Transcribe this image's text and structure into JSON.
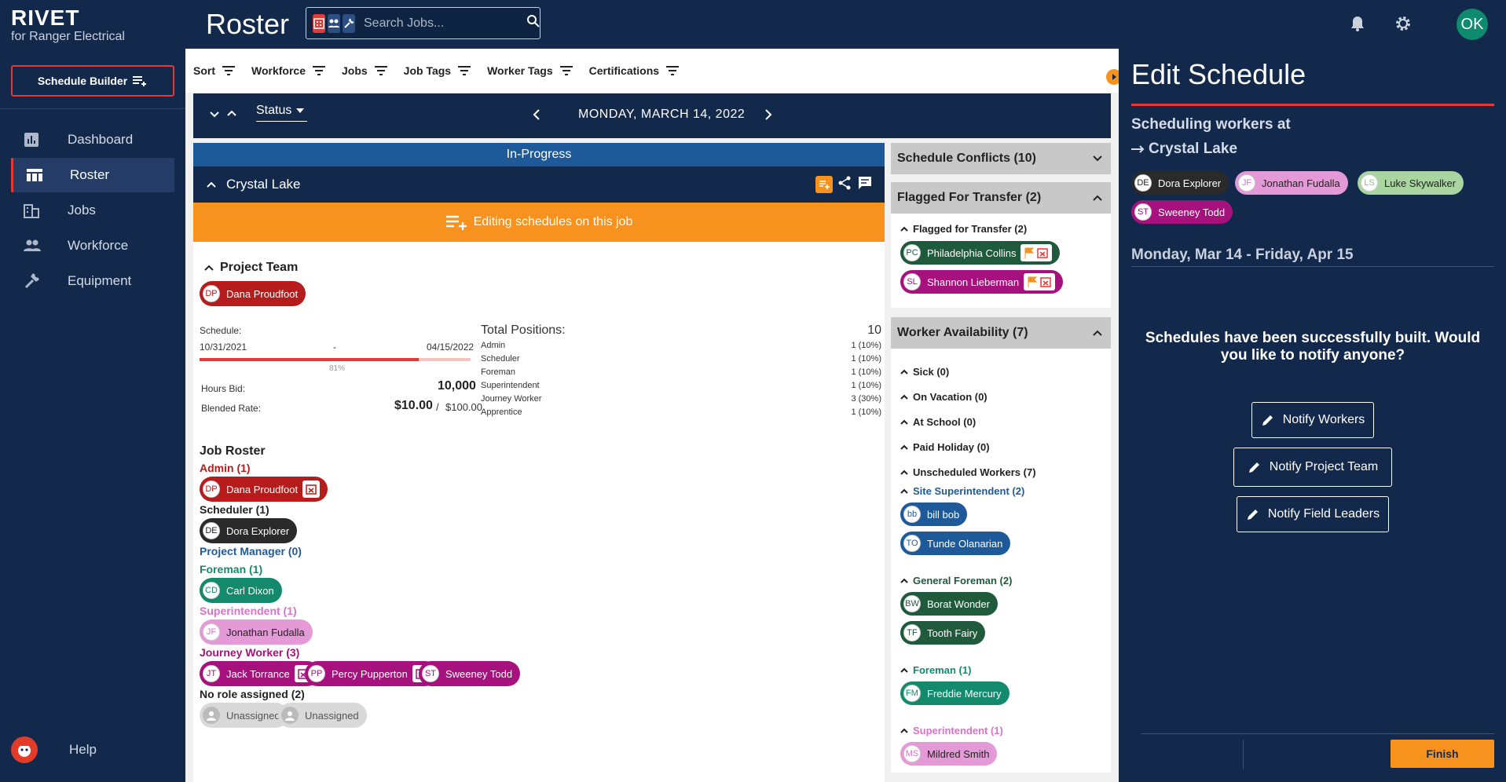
{
  "app": {
    "logo": "RIVET",
    "subtitle": "for Ranger Electrical",
    "page_title": "Roster"
  },
  "search": {
    "placeholder": "Search Jobs..."
  },
  "user": {
    "initials": "OK"
  },
  "sidebar": {
    "builder_label": "Schedule Builder",
    "items": [
      {
        "label": "Dashboard",
        "icon": "dashboard-icon"
      },
      {
        "label": "Roster",
        "icon": "roster-icon",
        "active": true
      },
      {
        "label": "Jobs",
        "icon": "jobs-icon"
      },
      {
        "label": "Workforce",
        "icon": "workforce-icon"
      },
      {
        "label": "Equipment",
        "icon": "equipment-icon"
      }
    ],
    "help": "Help"
  },
  "filters": [
    "Sort",
    "Workforce",
    "Jobs",
    "Job Tags",
    "Worker Tags",
    "Certifications"
  ],
  "datebar": {
    "status": "Status",
    "date": "MONDAY, MARCH 14, 2022"
  },
  "job": {
    "state": "In-Progress",
    "name": "Crystal Lake",
    "editing": "Editing schedules on this job",
    "project_team": {
      "title": "Project Team",
      "member": {
        "initials": "DP",
        "name": "Dana Proudfoot"
      }
    },
    "schedule": {
      "label": "Schedule:",
      "start": "10/31/2021",
      "dash": "-",
      "end": "04/15/2022",
      "progress_pct": 81,
      "progress_label": "81%"
    },
    "hours_bid": {
      "label": "Hours Bid:",
      "value": "10,000"
    },
    "blended": {
      "label": "Blended Rate:",
      "value": "$10.00",
      "sep": "/",
      "alt": "$100.00"
    },
    "positions": {
      "title": "Total Positions:",
      "total": "10",
      "rows": [
        {
          "role": "Admin",
          "value": "1 (10%)"
        },
        {
          "role": "Scheduler",
          "value": "1 (10%)"
        },
        {
          "role": "Foreman",
          "value": "1 (10%)"
        },
        {
          "role": "Superintendent",
          "value": "1 (10%)"
        },
        {
          "role": "Journey Worker",
          "value": "3 (30%)"
        },
        {
          "role": "Apprentice",
          "value": "1 (10%)"
        }
      ]
    },
    "roster_title": "Job Roster",
    "roles": {
      "admin": {
        "label": "Admin (1)",
        "workers": [
          {
            "initials": "DP",
            "name": "Dana Proudfoot"
          }
        ]
      },
      "scheduler": {
        "label": "Scheduler (1)",
        "workers": [
          {
            "initials": "DE",
            "name": "Dora Explorer"
          }
        ]
      },
      "pm": {
        "label": "Project Manager (0)"
      },
      "foreman": {
        "label": "Foreman (1)",
        "workers": [
          {
            "initials": "CD",
            "name": "Carl Dixon"
          }
        ]
      },
      "super": {
        "label": "Superintendent (1)",
        "workers": [
          {
            "initials": "JF",
            "name": "Jonathan Fudalla"
          }
        ]
      },
      "journey": {
        "label": "Journey Worker (3)",
        "workers": [
          {
            "initials": "JT",
            "name": "Jack Torrance"
          },
          {
            "initials": "PP",
            "name": "Percy Pupperton"
          },
          {
            "initials": "ST",
            "name": "Sweeney Todd"
          }
        ]
      },
      "none": {
        "label": "No role assigned (2)",
        "workers": [
          {
            "name": "Unassigned"
          },
          {
            "name": "Unassigned"
          }
        ]
      }
    }
  },
  "conflicts": {
    "title": "Schedule Conflicts (10)"
  },
  "transfer": {
    "title": "Flagged For Transfer (2)",
    "sub": "Flagged for Transfer (2)",
    "workers": [
      {
        "initials": "PC",
        "name": "Philadelphia Collins"
      },
      {
        "initials": "SL",
        "name": "Shannon Lieberman"
      }
    ]
  },
  "availability": {
    "title": "Worker Availability (7)",
    "groups": [
      "Sick (0)",
      "On Vacation (0)",
      "At School (0)",
      "Paid Holiday (0)",
      "Unscheduled Workers (7)"
    ],
    "site_super": {
      "label": "Site Superintendent (2)",
      "workers": [
        {
          "initials": "bb",
          "name": "bill bob"
        },
        {
          "initials": "TO",
          "name": "Tunde Olanarian"
        }
      ]
    },
    "gen_foreman": {
      "label": "General Foreman (2)",
      "workers": [
        {
          "initials": "BW",
          "name": "Borat Wonder"
        },
        {
          "initials": "TF",
          "name": "Tooth Fairy"
        }
      ]
    },
    "foreman": {
      "label": "Foreman (1)",
      "workers": [
        {
          "initials": "FM",
          "name": "Freddie Mercury"
        }
      ]
    },
    "super": {
      "label": "Superintendent (1)",
      "workers": [
        {
          "initials": "MS",
          "name": "Mildred Smith"
        }
      ]
    }
  },
  "edit": {
    "title": "Edit Schedule",
    "line1": "Scheduling workers at",
    "line2": "Crystal Lake",
    "workers": [
      {
        "initials": "DE",
        "name": "Dora Explorer"
      },
      {
        "initials": "JF",
        "name": "Jonathan Fudalla"
      },
      {
        "initials": "LS",
        "name": "Luke Skywalker"
      },
      {
        "initials": "ST",
        "name": "Sweeney Todd"
      }
    ],
    "range": "Monday, Mar 14 - Friday, Apr 15",
    "message": "Schedules have been successfully built. Would you like to notify anyone?",
    "buttons": [
      "Notify Workers",
      "Notify Project Team",
      "Notify Field Leaders"
    ],
    "finish": "Finish"
  },
  "colors": {
    "navy": "#13294b",
    "orange": "#f7921e",
    "red": "#e53935",
    "admin": "#b71c1c",
    "green": "#138a6b",
    "pink": "#d873c8",
    "magenta": "#a6117e",
    "blue": "#1e5a99",
    "darkgreen": "#1f5a3c"
  }
}
